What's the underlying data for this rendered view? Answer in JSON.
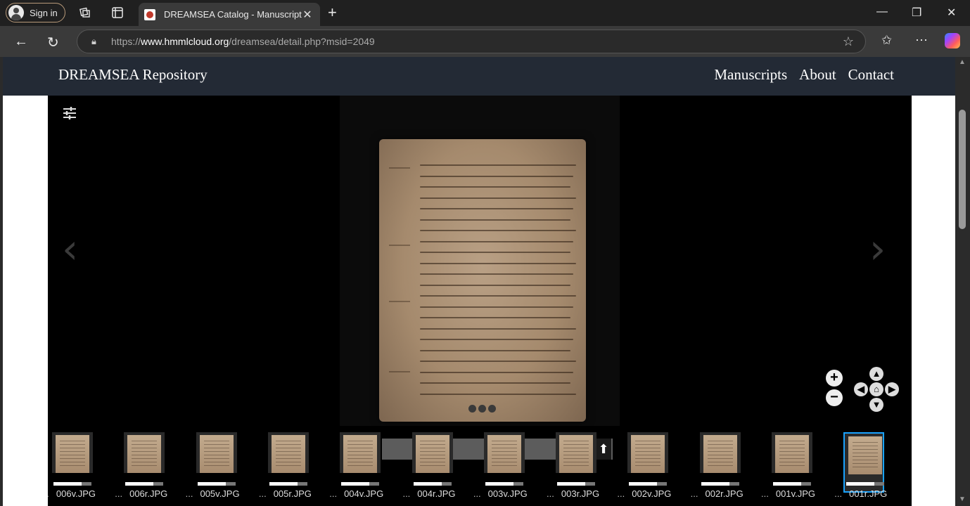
{
  "browser": {
    "signin_label": "Sign in",
    "tab_title": "DREAMSEA Catalog - Manuscript",
    "tab_close": "✕",
    "newtab": "+",
    "win_min": "—",
    "win_restore": "❐",
    "win_close": "✕",
    "url_prefix": "https://",
    "url_host": "www.hmmlcloud.org",
    "url_path": "/dreamsea/detail.php?msid=2049",
    "back": "←",
    "reload": "↻",
    "star": "☆",
    "favorites": "✩",
    "more": "⋯"
  },
  "site": {
    "title": "DREAMSEA Repository",
    "nav": [
      "Manuscripts",
      "About",
      "Contact"
    ]
  },
  "viewer": {
    "prev_arrow": "‹",
    "next_arrow": "›",
    "zoom_in": "+",
    "zoom_out": "−",
    "pan": {
      "up": "▲",
      "down": "▼",
      "left": "◀",
      "right": "▶",
      "home": "⌂"
    },
    "upload_icon": "⬆"
  },
  "thumbnails": [
    {
      "ellipsis": "...",
      "label": "006v.JPG",
      "selected": false
    },
    {
      "ellipsis": "...",
      "label": "006r.JPG",
      "selected": false
    },
    {
      "ellipsis": "...",
      "label": "005v.JPG",
      "selected": false
    },
    {
      "ellipsis": "...",
      "label": "005r.JPG",
      "selected": false
    },
    {
      "ellipsis": "...",
      "label": "004v.JPG",
      "selected": false
    },
    {
      "ellipsis": "...",
      "label": "004r.JPG",
      "selected": false
    },
    {
      "ellipsis": "...",
      "label": "003v.JPG",
      "selected": false
    },
    {
      "ellipsis": "...",
      "label": "003r.JPG",
      "selected": false
    },
    {
      "ellipsis": "...",
      "label": "002v.JPG",
      "selected": false
    },
    {
      "ellipsis": "...",
      "label": "002r.JPG",
      "selected": false
    },
    {
      "ellipsis": "...",
      "label": "001v.JPG",
      "selected": false
    },
    {
      "ellipsis": "...",
      "label": "001r.JPG",
      "selected": true
    }
  ],
  "colors": {
    "header_bg": "#232a35",
    "selection": "#1aa3ff",
    "viewer_bg": "#000000"
  }
}
